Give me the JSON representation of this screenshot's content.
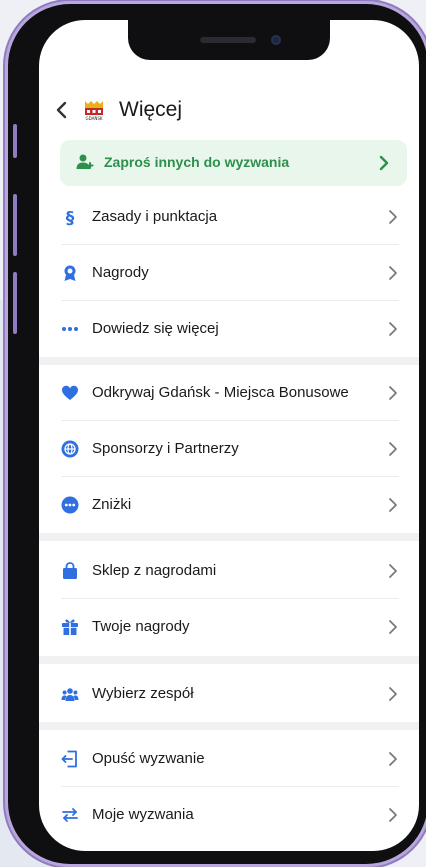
{
  "header": {
    "title": "Więcej",
    "logo_text": "GDAŃSK"
  },
  "invite": {
    "label": "Zaproś innych do wyzwania"
  },
  "menu": {
    "rules": "Zasady i punktacja",
    "prizes": "Nagrody",
    "learn_more": "Dowiedz się więcej",
    "explore": "Odkrywaj Gdańsk - Miejsca Bonusowe",
    "sponsors": "Sponsorzy i Partnerzy",
    "discounts": "Zniżki",
    "shop": "Sklep z nagrodami",
    "your_prizes": "Twoje nagrody",
    "team": "Wybierz zespół",
    "leave": "Opuść wyzwanie",
    "my_challenges": "Moje wyzwania"
  },
  "colors": {
    "accent": "#2f6fe0",
    "green": "#2f8f4c",
    "green_bg": "#e8f6ec",
    "frame": "#8f7cc0"
  },
  "icons": {
    "rules": "section-sign-icon",
    "prizes": "medal-icon",
    "learn_more": "more-dots-icon",
    "explore": "heart-icon",
    "sponsors": "globe-icon",
    "discounts": "more-circle-icon",
    "shop": "shopping-bag-icon",
    "your_prizes": "gift-icon",
    "team": "team-icon",
    "leave": "exit-icon",
    "my_challenges": "swap-icon"
  }
}
